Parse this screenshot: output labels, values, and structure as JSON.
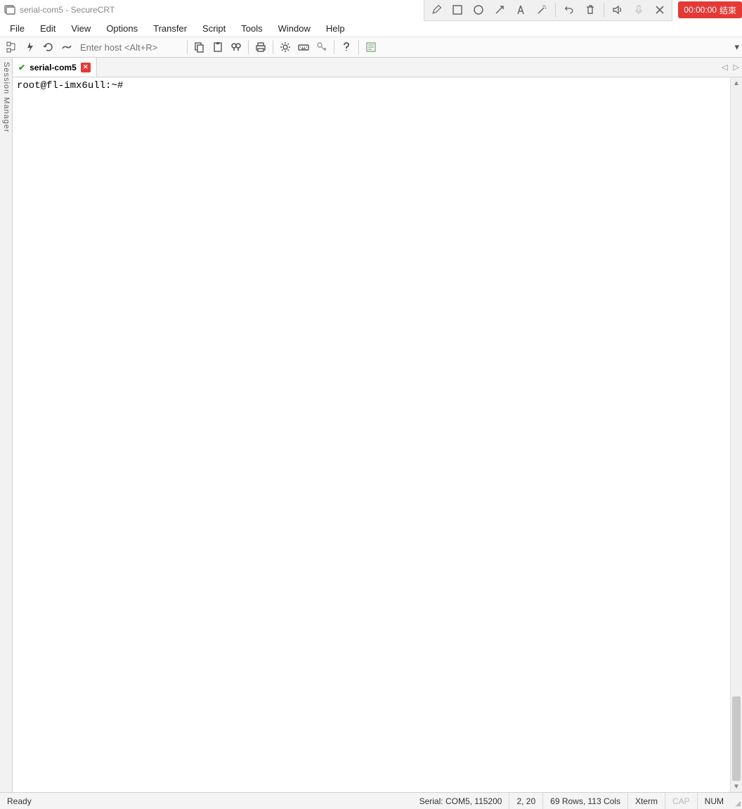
{
  "title": "serial-com5 - SecureCRT",
  "recorder": {
    "time": "00:00:00",
    "label": "结束"
  },
  "menu": [
    "File",
    "Edit",
    "View",
    "Options",
    "Transfer",
    "Script",
    "Tools",
    "Window",
    "Help"
  ],
  "toolbar": {
    "host_placeholder": "Enter host <Alt+R>"
  },
  "session_manager_label": "Session Manager",
  "tabs": [
    {
      "name": "serial-com5"
    }
  ],
  "terminal": {
    "line1": "root@fl-imx6ull:~#"
  },
  "status": {
    "ready": "Ready",
    "conn": "Serial: COM5, 115200",
    "cursor": "2,  20",
    "size": "69 Rows, 113 Cols",
    "emul": "Xterm",
    "cap": "CAP",
    "num": "NUM"
  }
}
